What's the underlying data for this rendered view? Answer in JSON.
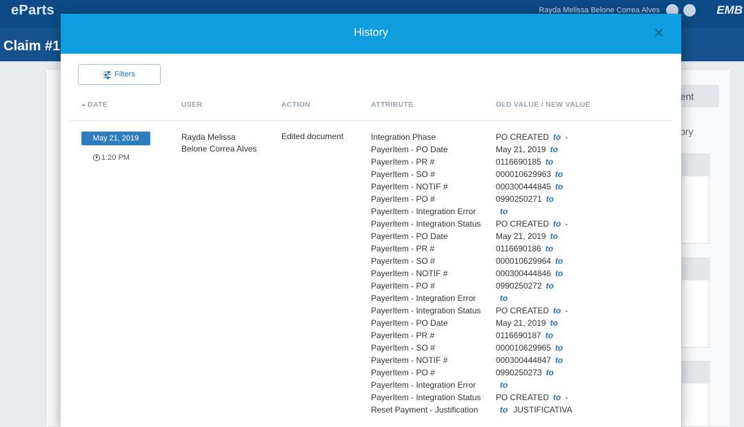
{
  "app": {
    "logo": "eParts",
    "user_name": "Rayda Melissa Belone Correa Alves",
    "brand": "EMB",
    "claim_title": "Claim #1",
    "bg_tab_label": "yment",
    "bg_history_label": "ory"
  },
  "modal": {
    "title": "History",
    "close_label": "×",
    "filters_label": "Filters",
    "columns": {
      "date": "DATE",
      "user": "USER",
      "action": "ACTION",
      "attribute": "ATTRIBUTE",
      "values": "OLD VALUE / NEW VALUE"
    },
    "entry": {
      "date": "May 21, 2019",
      "time": "1:20 PM",
      "user": "Rayda Melissa Belone Correa Alves",
      "action": "Edited document",
      "to_label": "to",
      "attributes": [
        "Integration Phase",
        "PayerItem - PO Date",
        "PayerItem - PR #",
        "PayerItem - SO #",
        "PayerItem - NOTIF #",
        "PayerItem - PO #",
        "PayerItem - Integration Error",
        "PayerItem - Integration Status",
        "PayerItem - PO Date",
        "PayerItem - PR #",
        "PayerItem - SO #",
        "PayerItem - NOTIF #",
        "PayerItem - PO #",
        "PayerItem - Integration Error",
        "PayerItem - Integration Status",
        "PayerItem - PO Date",
        "PayerItem - PR #",
        "PayerItem - SO #",
        "PayerItem - NOTIF #",
        "PayerItem - PO #",
        "PayerItem - Integration Error",
        "PayerItem - Integration Status",
        "Reset Payment - Justification"
      ],
      "values": [
        {
          "old": "PO CREATED",
          "new": "-"
        },
        {
          "old": "May 21, 2019",
          "new": ""
        },
        {
          "old": "0116690185",
          "new": ""
        },
        {
          "old": "000010629963",
          "new": ""
        },
        {
          "old": "000300444845",
          "new": ""
        },
        {
          "old": "0990250271",
          "new": ""
        },
        {
          "old": "",
          "new": ""
        },
        {
          "old": "PO CREATED",
          "new": "-"
        },
        {
          "old": "May 21, 2019",
          "new": ""
        },
        {
          "old": "0116690186",
          "new": ""
        },
        {
          "old": "000010629964",
          "new": ""
        },
        {
          "old": "000300444846",
          "new": ""
        },
        {
          "old": "0990250272",
          "new": ""
        },
        {
          "old": "",
          "new": ""
        },
        {
          "old": "PO CREATED",
          "new": "-"
        },
        {
          "old": "May 21, 2019",
          "new": ""
        },
        {
          "old": "0116690187",
          "new": ""
        },
        {
          "old": "000010629965",
          "new": ""
        },
        {
          "old": "000300444847",
          "new": ""
        },
        {
          "old": "0990250273",
          "new": ""
        },
        {
          "old": "",
          "new": ""
        },
        {
          "old": "PO CREATED",
          "new": "-"
        },
        {
          "old": "",
          "new": "JUSTIFICATIVA"
        }
      ]
    }
  }
}
